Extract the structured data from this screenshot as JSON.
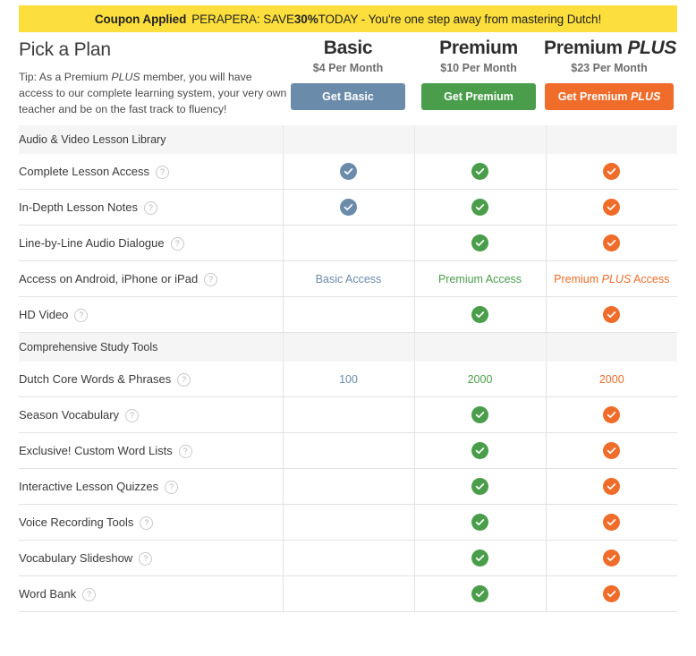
{
  "banner": {
    "label": "Coupon Applied",
    "message": "PERAPERA: SAVE 30% TODAY - You're one step away from mastering Dutch!",
    "message_pre": "PERAPERA: SAVE ",
    "message_strong": "30%",
    "message_post": " TODAY - You're one step away from mastering Dutch!",
    "background_color": "#fcdf3c"
  },
  "header": {
    "title": "Pick a Plan",
    "tip_pre": "Tip: As a Premium ",
    "tip_italic": "PLUS",
    "tip_post": " member, you will have access to our complete learning system, your very own teacher and be on the fast track to fluency!"
  },
  "plans": [
    {
      "name": "Basic",
      "name_italic": "",
      "price": "$4 Per Month",
      "cta": "Get Basic",
      "cta_italic": "",
      "color": "#6b8bab",
      "key": "basic"
    },
    {
      "name": "Premium",
      "name_italic": "",
      "price": "$10 Per Month",
      "cta": "Get Premium",
      "cta_italic": "",
      "color": "#4a9d4a",
      "key": "premium"
    },
    {
      "name": "Premium ",
      "name_italic": "PLUS",
      "price": "$23 Per Month",
      "cta": "Get Premium ",
      "cta_italic": "PLUS",
      "color": "#ef6c2a",
      "key": "plus"
    }
  ],
  "sections": [
    {
      "title": "Audio & Video Lesson Library",
      "rows": [
        {
          "feature": "Complete Lesson Access",
          "help": "?",
          "basic": {
            "type": "check"
          },
          "premium": {
            "type": "check"
          },
          "plus": {
            "type": "check"
          }
        },
        {
          "feature": "In-Depth Lesson Notes",
          "help": "?",
          "basic": {
            "type": "check"
          },
          "premium": {
            "type": "check"
          },
          "plus": {
            "type": "check"
          }
        },
        {
          "feature": "Line-by-Line Audio Dialogue",
          "help": "?",
          "basic": {
            "type": "empty"
          },
          "premium": {
            "type": "check"
          },
          "plus": {
            "type": "check"
          }
        },
        {
          "feature": "Access on Android, iPhone or iPad",
          "help": "?",
          "basic": {
            "type": "text",
            "text": "Basic Access"
          },
          "premium": {
            "type": "text",
            "text": "Premium Access"
          },
          "plus": {
            "type": "text",
            "text": "Premium ",
            "text_italic": "PLUS",
            "text_post": " Access"
          }
        },
        {
          "feature": "HD Video",
          "help": "?",
          "basic": {
            "type": "empty"
          },
          "premium": {
            "type": "check"
          },
          "plus": {
            "type": "check"
          }
        }
      ]
    },
    {
      "title": "Comprehensive Study Tools",
      "rows": [
        {
          "feature": "Dutch Core Words & Phrases",
          "help": "?",
          "basic": {
            "type": "text",
            "text": "100"
          },
          "premium": {
            "type": "text",
            "text": "2000"
          },
          "plus": {
            "type": "text",
            "text": "2000"
          }
        },
        {
          "feature": "Season Vocabulary",
          "help": "?",
          "basic": {
            "type": "empty"
          },
          "premium": {
            "type": "check"
          },
          "plus": {
            "type": "check"
          }
        },
        {
          "feature": "Exclusive! Custom Word Lists",
          "help": "?",
          "basic": {
            "type": "empty"
          },
          "premium": {
            "type": "check"
          },
          "plus": {
            "type": "check"
          }
        },
        {
          "feature": "Interactive Lesson Quizzes",
          "help": "?",
          "basic": {
            "type": "empty"
          },
          "premium": {
            "type": "check"
          },
          "plus": {
            "type": "check"
          }
        },
        {
          "feature": "Voice Recording Tools",
          "help": "?",
          "basic": {
            "type": "empty"
          },
          "premium": {
            "type": "check"
          },
          "plus": {
            "type": "check"
          }
        },
        {
          "feature": "Vocabulary Slideshow",
          "help": "?",
          "basic": {
            "type": "empty"
          },
          "premium": {
            "type": "check"
          },
          "plus": {
            "type": "check"
          }
        },
        {
          "feature": "Word Bank",
          "help": "?",
          "basic": {
            "type": "empty"
          },
          "premium": {
            "type": "check"
          },
          "plus": {
            "type": "check"
          }
        }
      ]
    }
  ]
}
